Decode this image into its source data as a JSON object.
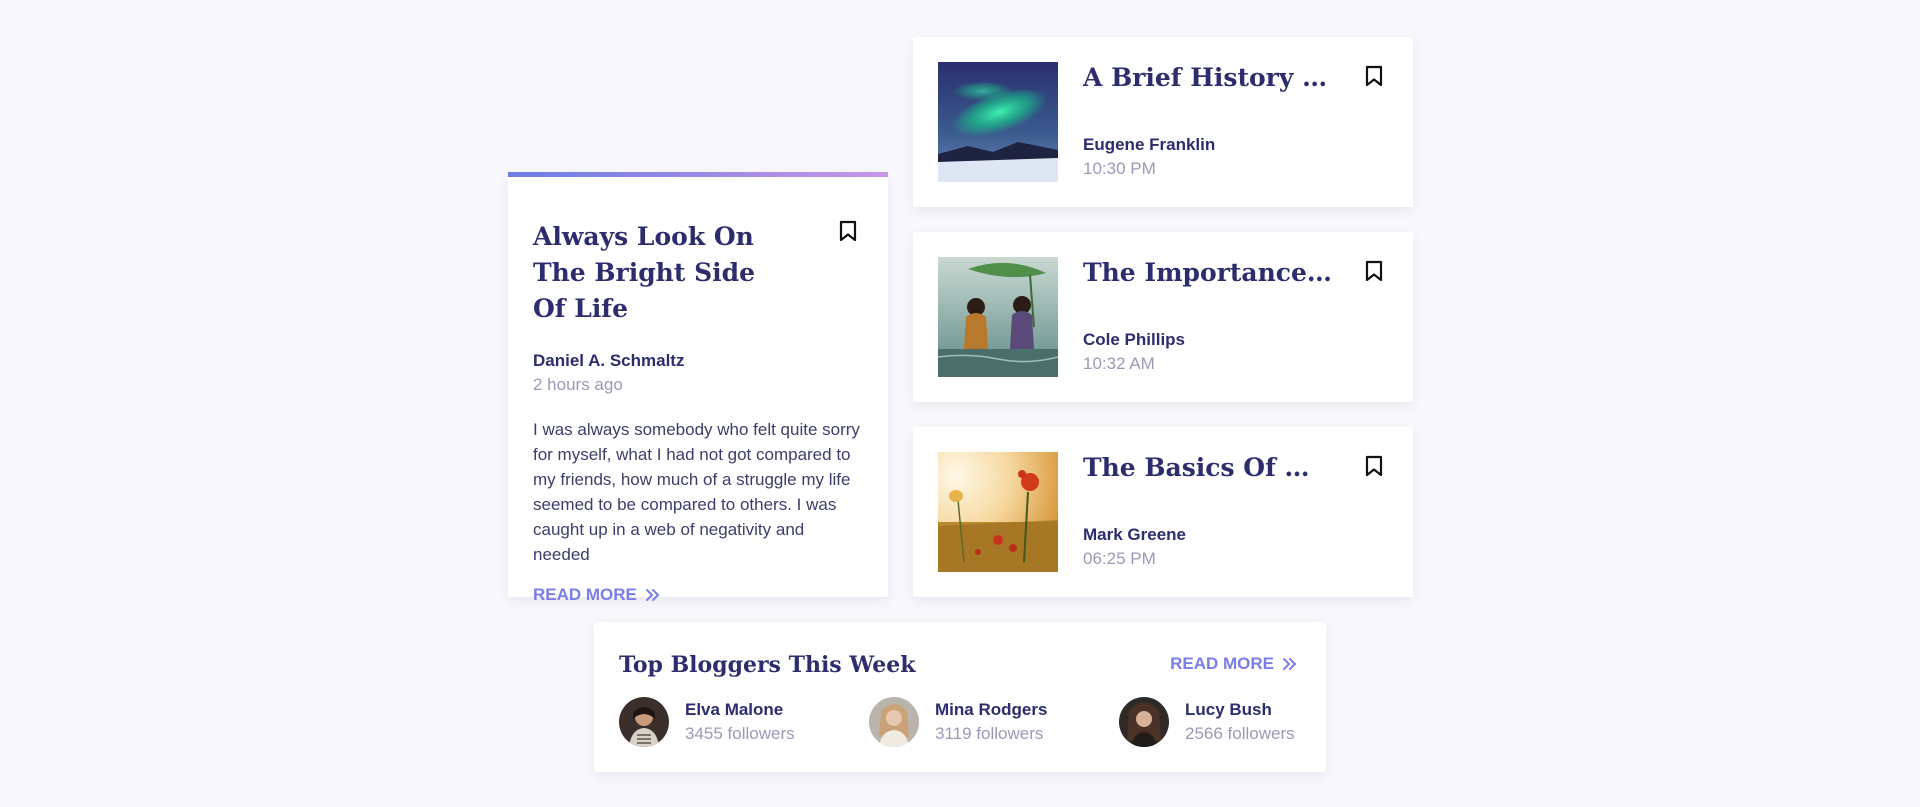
{
  "featured": {
    "title": "Always Look On The Bright Side Of Life",
    "author": "Daniel A. Schmaltz",
    "time": "2 hours ago",
    "excerpt": "I was always somebody who felt quite sorry for myself, what I had not got compared to my friends, how much of a struggle my life seemed to be compared to others. I was caught up in a web of negativity and needed",
    "read_more": "READ MORE",
    "accent_gradient": [
      "#6b7de6",
      "#c896e8"
    ]
  },
  "posts": [
    {
      "title": "A Brief History Of C...",
      "author": "Eugene Franklin",
      "time": "10:30 PM",
      "thumb": "aurora-image"
    },
    {
      "title": "The Importance Of ...",
      "author": "Cole Phillips",
      "time": "10:32 AM",
      "thumb": "children-leaf-image"
    },
    {
      "title": "The Basics Of Weste...",
      "author": "Mark Greene",
      "time": "06:25 PM",
      "thumb": "poppy-field-image"
    }
  ],
  "bloggers": {
    "heading": "Top Bloggers This Week",
    "read_more": "READ MORE",
    "items": [
      {
        "name": "Elva Malone",
        "followers": "3455 followers"
      },
      {
        "name": "Mina Rodgers",
        "followers": "3119 followers"
      },
      {
        "name": "Lucy Bush",
        "followers": "2566 followers"
      }
    ]
  },
  "colors": {
    "background": "#f8f8fc",
    "title": "#2d2d6e",
    "muted": "#9a9ab8",
    "accent": "#7b7ee8"
  }
}
